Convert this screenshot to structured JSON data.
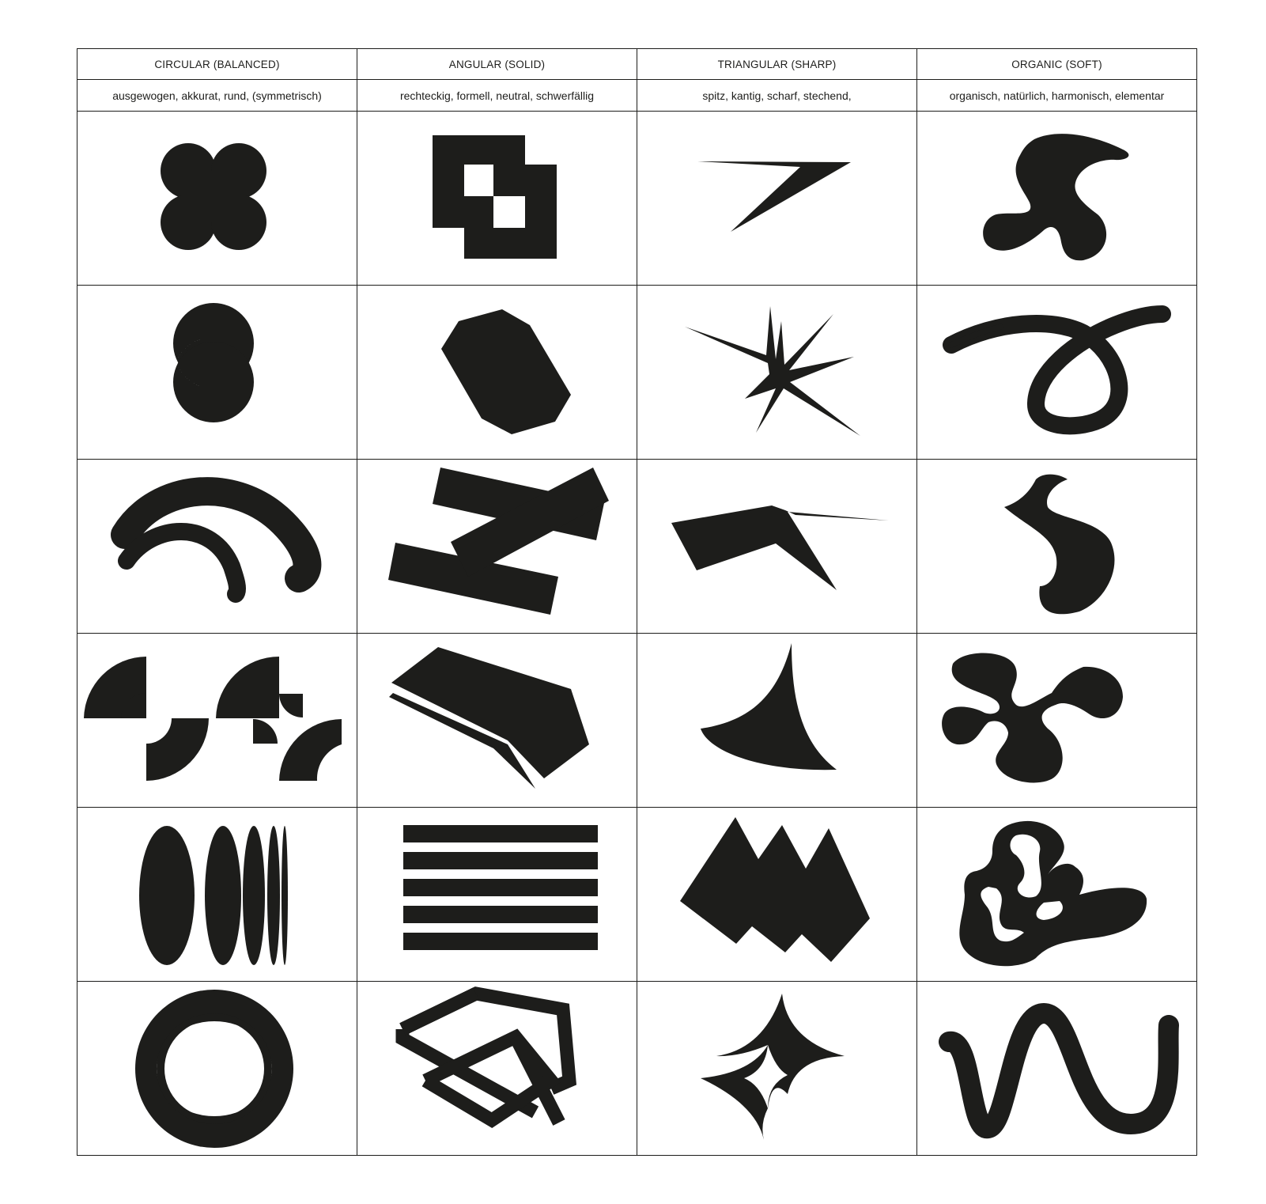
{
  "table": {
    "columns": [
      {
        "heading": "CIRCULAR (BALANCED)",
        "description": "ausgewogen, akkurat, rund, (symmetrisch)"
      },
      {
        "heading": "ANGULAR (SOLID)",
        "description": "rechteckig, formell, neutral, schwerfällig"
      },
      {
        "heading": "TRIANGULAR (SHARP)",
        "description": "spitz, kantig, scharf, stechend,"
      },
      {
        "heading": "ORGANIC (SOFT)",
        "description": "organisch, natürlich, harmonisch, elementar"
      }
    ]
  },
  "colors": {
    "ink": "#1d1d1b",
    "background": "#ffffff",
    "grid": "#1d1d1b"
  }
}
